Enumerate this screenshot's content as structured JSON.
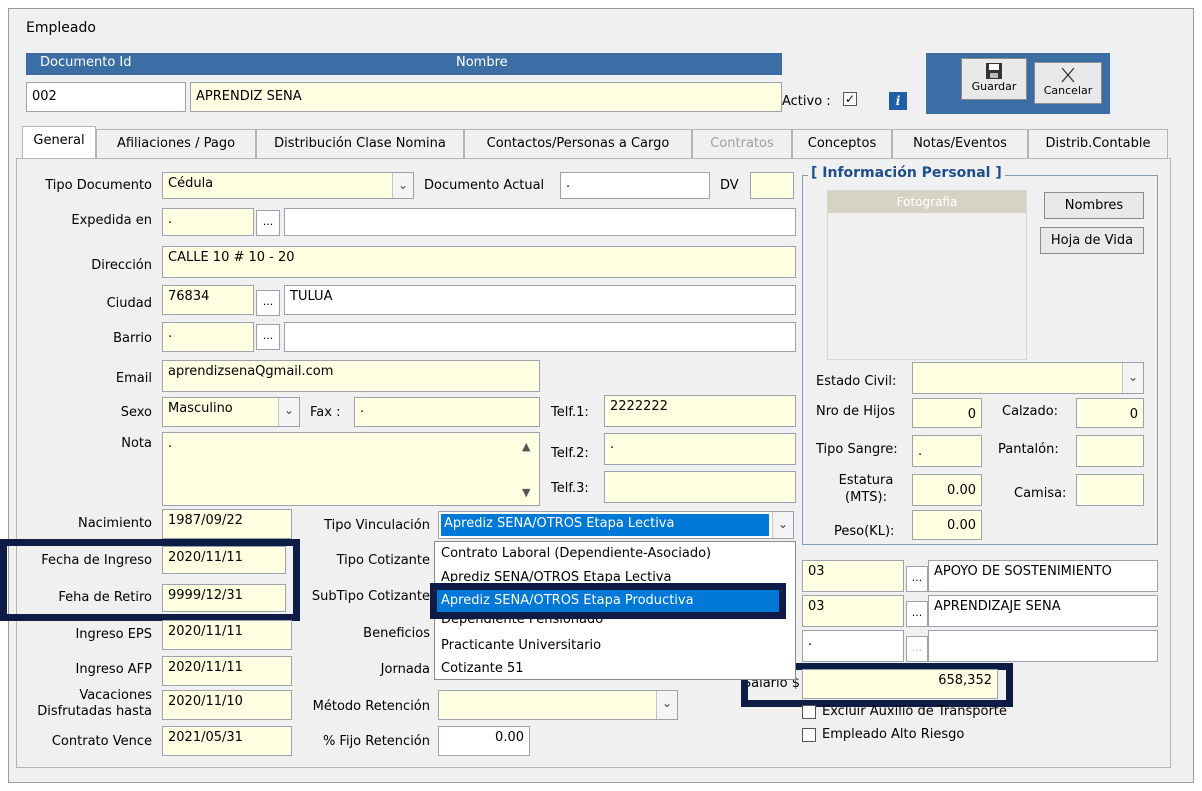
{
  "window_title": "Empleado",
  "header": {
    "documento_id_label": "Documento Id",
    "nombre_label": "Nombre",
    "documento_id_value": "002",
    "nombre_value": "APRENDIZ SENA",
    "activo_label": "Activo :",
    "activo_checked": "✓",
    "info_icon": "i",
    "guardar_label": "Guardar",
    "cancelar_label": "Cancelar"
  },
  "tabs": [
    {
      "label": "General",
      "active": true
    },
    {
      "label": "Afiliaciones / Pago"
    },
    {
      "label": "Distribución Clase Nomina"
    },
    {
      "label": "Contactos/Personas a Cargo"
    },
    {
      "label": "Contratos",
      "disabled": true
    },
    {
      "label": "Conceptos"
    },
    {
      "label": "Notas/Eventos"
    },
    {
      "label": "Distrib.Contable"
    }
  ],
  "general": {
    "tipo_documento_label": "Tipo Documento",
    "tipo_documento_value": "Cédula",
    "documento_actual_label": "Documento Actual",
    "documento_actual_value": ".",
    "dv_label": "DV",
    "dv_value": "",
    "expedida_label": "Expedida en",
    "expedida_code": ".",
    "expedida_name": "",
    "direccion_label": "Dirección",
    "direccion_value": "CALLE 10 # 10 - 20",
    "ciudad_label": "Ciudad",
    "ciudad_code": "76834",
    "ciudad_name": "TULUA",
    "barrio_label": "Barrio",
    "barrio_code": ".",
    "barrio_name": "",
    "email_label": "Email",
    "email_value": "aprendizsenaQgmail.com",
    "sexo_label": "Sexo",
    "sexo_value": "Masculino",
    "fax_label": "Fax :",
    "fax_value": ".",
    "telf1_label": "Telf.1:",
    "telf1_value": "2222222",
    "telf2_label": "Telf.2:",
    "telf2_value": ".",
    "telf3_label": "Telf.3:",
    "telf3_value": "",
    "nota_label": "Nota",
    "nota_value": ".",
    "nacimiento_label": "Nacimiento",
    "nacimiento_value": "1987/09/22",
    "fecha_ingreso_label": "Fecha de Ingreso",
    "fecha_ingreso_value": "2020/11/11",
    "fecha_retiro_label": "Feha de Retiro",
    "fecha_retiro_value": "9999/12/31",
    "ingreso_eps_label": "Ingreso EPS",
    "ingreso_eps_value": "2020/11/11",
    "ingreso_afp_label": "Ingreso AFP",
    "ingreso_afp_value": "2020/11/11",
    "vacaciones_label_1": "Vacaciones",
    "vacaciones_label_2": "Disfrutadas hasta",
    "vacaciones_value": "2020/11/10",
    "contrato_vence_label": "Contrato Vence",
    "contrato_vence_value": "2021/05/31",
    "tipo_vinculacion_label": "Tipo Vinculación",
    "tipo_vinculacion_value": "Aprediz SENA/OTROS Etapa Lectiva",
    "tipo_cotizante_label": "Tipo Cotizante",
    "subtipo_cotizante_label": "SubTipo Cotizante",
    "beneficios_label": "Beneficios",
    "jornada_label": "Jornada",
    "metodo_retencion_label": "Método Retención",
    "metodo_retencion_value": "",
    "fijo_retencion_label": "% Fijo Retención",
    "fijo_retencion_value": "0.00",
    "dropdown_options": [
      "Contrato Laboral (Dependiente-Asociado)",
      "Aprediz SENA/OTROS Etapa Lectiva",
      "Aprediz SENA/OTROS Etapa Productiva",
      "Dependiente Pensionado",
      "Practicante Universitario",
      "Cotizante 51"
    ],
    "dropdown_selected_index": 2,
    "tipo_cotizante_code": "03",
    "tipo_cotizante_name": "APOYO DE SOSTENIMIENTO",
    "subtipo_code": "03",
    "subtipo_name": "APRENDIZAJE SENA",
    "beneficios_code": ".",
    "beneficios_name": "",
    "salario_label": "Salario $",
    "salario_value": "658,352",
    "excluir_auxilio_label": "Excluir Auxilio de Transporte",
    "alto_riesgo_label": "Empleado Alto Riesgo"
  },
  "personal": {
    "group_title": "[ Información Personal ]",
    "fotografia_label": "Fotografia",
    "nombres_button": "Nombres",
    "hoja_vida_button": "Hoja de Vida",
    "estado_civil_label": "Estado Civil:",
    "estado_civil_value": "",
    "nro_hijos_label": "Nro de Hijos",
    "nro_hijos_value": "0",
    "calzado_label": "Calzado:",
    "calzado_value": "0",
    "tipo_sangre_label": "Tipo Sangre:",
    "tipo_sangre_value": ".",
    "pantalon_label": "Pantalón:",
    "pantalon_value": "",
    "estatura_label_1": "Estatura",
    "estatura_label_2": "(MTS):",
    "estatura_value": "0.00",
    "camisa_label": "Camisa:",
    "camisa_value": "",
    "peso_label": "Peso(KL):",
    "peso_value": "0.00"
  },
  "colors": {
    "field_bg": "#ffffe1",
    "header_bar": "#3a6ea5",
    "highlight_border": "#0d1b45",
    "selection": "#0078d7"
  }
}
